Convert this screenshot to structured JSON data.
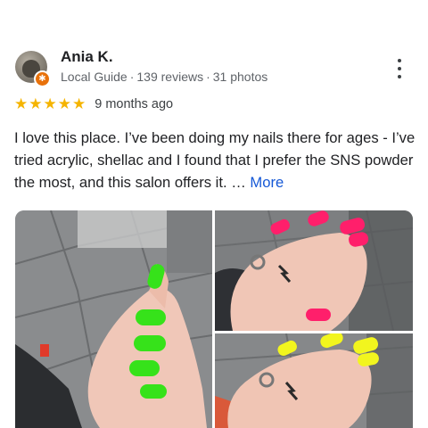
{
  "review": {
    "author_name": "Ania K.",
    "author_meta": {
      "badge": "Local Guide",
      "reviews": "139 reviews",
      "photos": "31 photos",
      "separator": "·"
    },
    "rating": 5,
    "star_glyph": "★",
    "time_ago": "9 months ago",
    "text_body": "I love this place. I’ve been doing my nails there for ages - I’ve tried acrylic, shellac and I found that I prefer the SNS powder the most, and this salon offers it. …",
    "more_label": "More",
    "colors": {
      "star": "#f5b400",
      "link": "#1558d6",
      "badge": "#e8710a"
    }
  },
  "photos": [
    {
      "subject": "hand with neon green nails on pavement"
    },
    {
      "subject": "hand with neon pink nails and lightning tattoo"
    },
    {
      "subject": "hand with neon yellow nails and lightning tattoo"
    }
  ],
  "icons": {
    "overflow_menu": "more-vert-icon",
    "local_guide": "local-guide-badge-icon"
  }
}
